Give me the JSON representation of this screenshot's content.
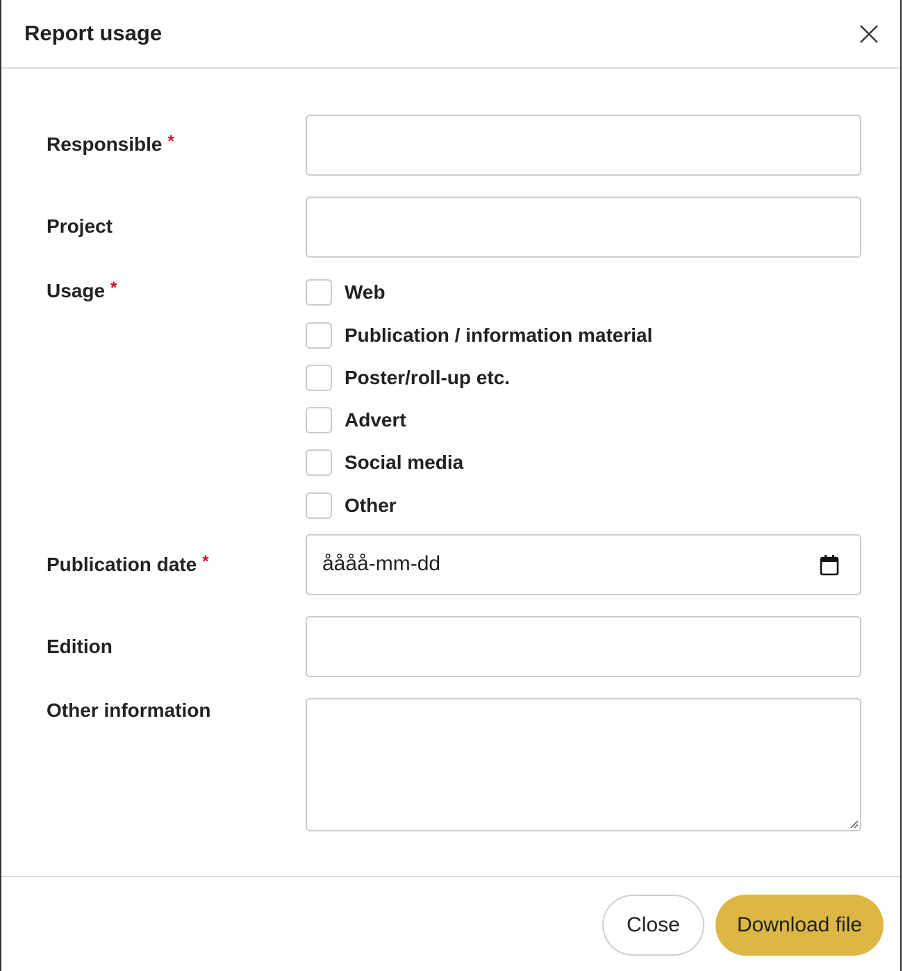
{
  "dialog": {
    "title": "Report usage",
    "close_icon": "close-icon"
  },
  "form": {
    "responsible": {
      "label": "Responsible",
      "required": "*",
      "value": ""
    },
    "project": {
      "label": "Project",
      "value": ""
    },
    "usage": {
      "label": "Usage",
      "required": "*",
      "options": [
        {
          "label": "Web",
          "checked": false
        },
        {
          "label": "Publication / information material",
          "checked": false
        },
        {
          "label": "Poster/roll-up etc.",
          "checked": false
        },
        {
          "label": "Advert",
          "checked": false
        },
        {
          "label": "Social media",
          "checked": false
        },
        {
          "label": "Other",
          "checked": false
        }
      ]
    },
    "publication_date": {
      "label": "Publication date",
      "required": "*",
      "placeholder": "åååå-mm-dd",
      "icon": "calendar-icon"
    },
    "edition": {
      "label": "Edition",
      "value": ""
    },
    "other_information": {
      "label": "Other information",
      "value": ""
    }
  },
  "footer": {
    "close_label": "Close",
    "download_label": "Download file",
    "download_color": "#dcb743"
  }
}
